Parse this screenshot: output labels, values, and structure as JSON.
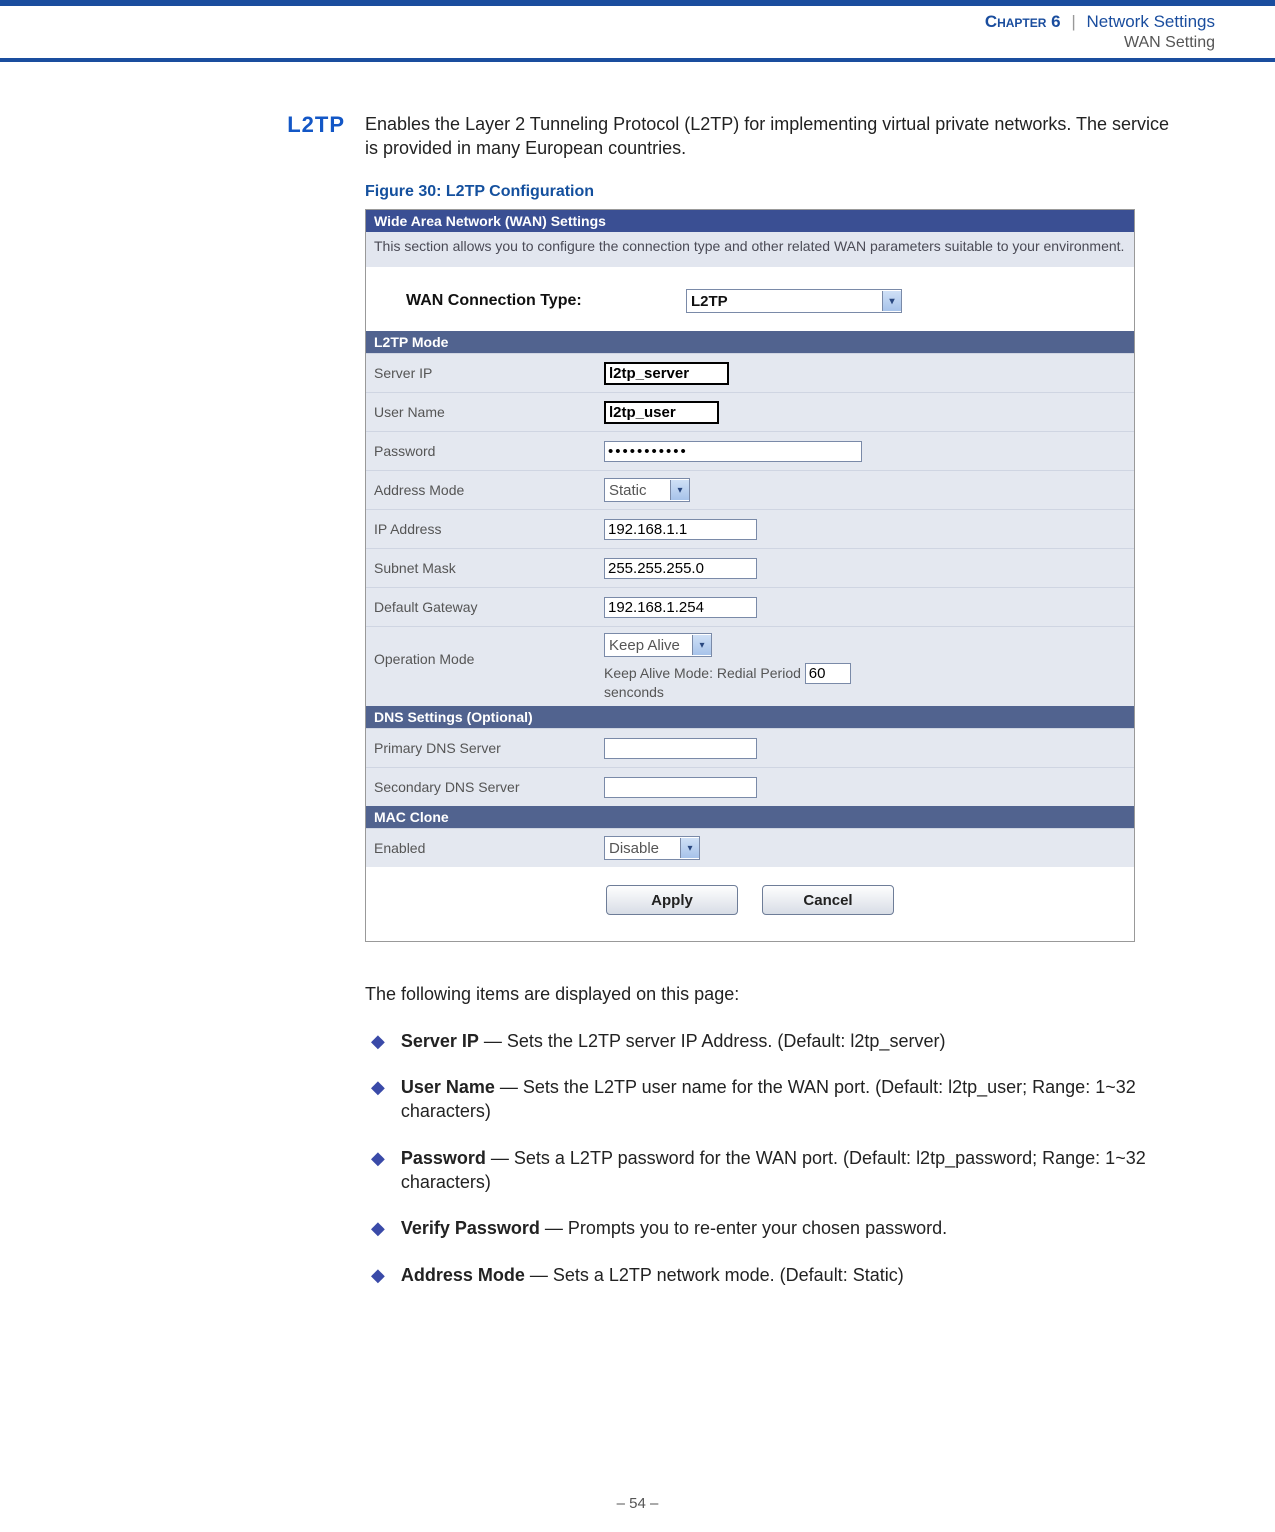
{
  "header": {
    "chapter": "Chapter 6",
    "sep": "|",
    "title": "Network Settings",
    "subtitle": "WAN Setting"
  },
  "side_heading": "L2TP",
  "intro": "Enables the Layer 2 Tunneling Protocol (L2TP) for implementing virtual private networks. The service is provided in many European countries.",
  "figure_caption": "Figure 30:  L2TP Configuration",
  "panel": {
    "title": "Wide Area Network (WAN) Settings",
    "info": "This section allows you to configure the connection type and other related WAN parameters suitable to your environment.",
    "wan_label": "WAN Connection Type:",
    "wan_value": "L2TP",
    "sect_l2tp": "L2TP Mode",
    "server_ip_label": "Server IP",
    "server_ip_value": "l2tp_server",
    "user_label": "User Name",
    "user_value": "l2tp_user",
    "pw_label": "Password",
    "pw_value": "•••••••••••",
    "addr_mode_label": "Address Mode",
    "addr_mode_value": "Static",
    "ip_label": "IP Address",
    "ip_value": "192.168.1.1",
    "mask_label": "Subnet Mask",
    "mask_value": "255.255.255.0",
    "gw_label": "Default Gateway",
    "gw_value": "192.168.1.254",
    "op_label": "Operation Mode",
    "op_value": "Keep Alive",
    "op_text_a": "Keep Alive Mode: Redial Period",
    "op_period": "60",
    "op_text_b": "senconds",
    "sect_dns": "DNS Settings (Optional)",
    "dns1_label": "Primary DNS Server",
    "dns2_label": "Secondary DNS Server",
    "sect_mac": "MAC Clone",
    "mac_en_label": "Enabled",
    "mac_en_value": "Disable",
    "apply": "Apply",
    "cancel": "Cancel"
  },
  "following": "The following items are displayed on this page:",
  "items": [
    {
      "term": "Server IP",
      "desc": " — Sets the L2TP server IP Address. (Default: l2tp_server)"
    },
    {
      "term": "User Name",
      "desc": " — Sets the L2TP user name for the WAN port. (Default: l2tp_user; Range: 1~32 characters)"
    },
    {
      "term": "Password",
      "desc": " — Sets a L2TP password for the WAN port. (Default: l2tp_password; Range: 1~32 characters)"
    },
    {
      "term": "Verify Password",
      "desc": " — Prompts you to re-enter your chosen password."
    },
    {
      "term": "Address Mode",
      "desc": " — Sets a L2TP network mode. (Default: Static)"
    }
  ],
  "page_number": "–  54  –"
}
